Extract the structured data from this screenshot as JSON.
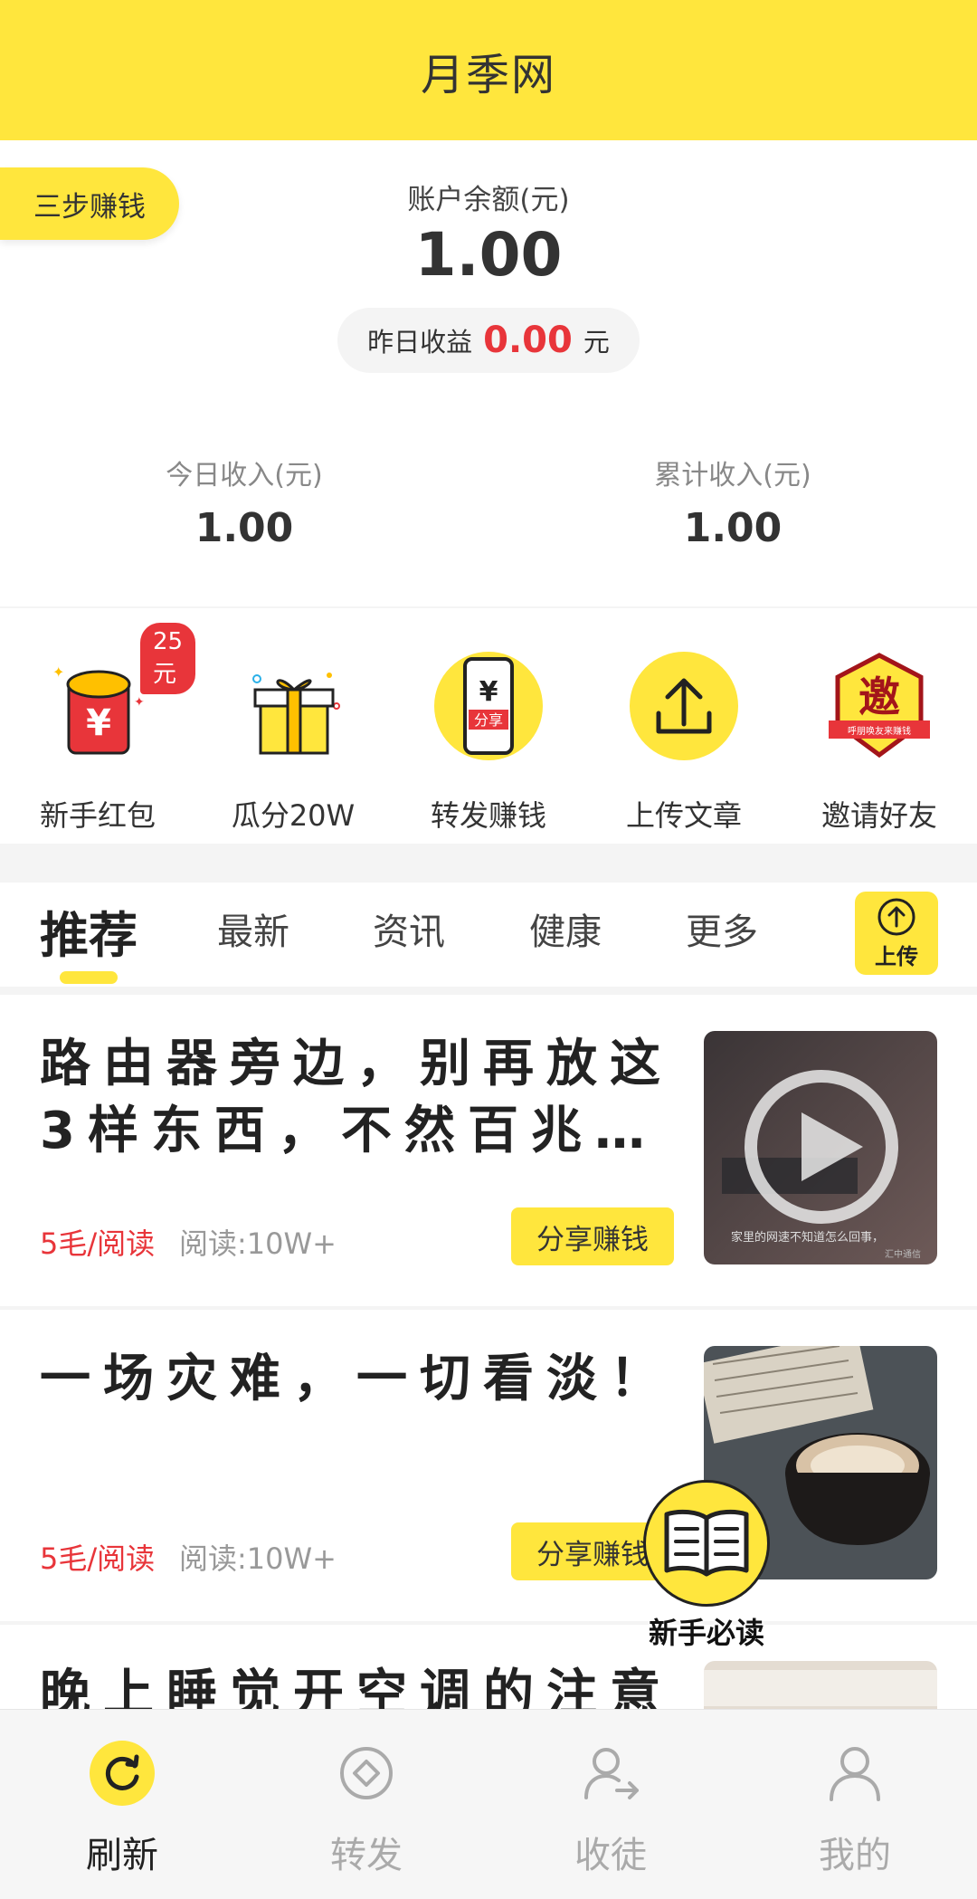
{
  "header": {
    "title": "月季网"
  },
  "balance": {
    "steps_button": "三步赚钱",
    "label": "账户余额(元)",
    "value": "1.00",
    "yesterday_label": "昨日收益",
    "yesterday_value": "0.00",
    "yesterday_unit": "元",
    "today_label": "今日收入(元)",
    "today_value": "1.00",
    "total_label": "累计收入(元)",
    "total_value": "1.00"
  },
  "shortcuts": [
    {
      "label": "新手红包",
      "badge": "25元",
      "icon": "red-packet-icon"
    },
    {
      "label": "瓜分20W",
      "icon": "gift-box-icon"
    },
    {
      "label": "转发赚钱",
      "icon": "phone-share-icon",
      "glyph": "¥",
      "sub": "分享"
    },
    {
      "label": "上传文章",
      "icon": "upload-icon"
    },
    {
      "label": "邀请好友",
      "icon": "invite-badge-icon",
      "glyph": "邀",
      "sub": "呼朋唤友来赚钱"
    }
  ],
  "tabs": {
    "items": [
      "推荐",
      "最新",
      "资讯",
      "健康",
      "更多"
    ],
    "active": "推荐",
    "upload_label": "上传"
  },
  "articles": [
    {
      "title": "路由器旁边，别再放这3样东西，不然百兆…",
      "price": "5毛/阅读",
      "reads": "阅读:10W+",
      "share": "分享赚钱",
      "thumb_caption": "家里的网速不知道怎么回事，",
      "thumb_source": "汇中通信"
    },
    {
      "title": "一场灾难，一切看淡！",
      "price": "5毛/阅读",
      "reads": "阅读:10W+",
      "share": "分享赚钱"
    },
    {
      "title": "晚上睡觉开空调的注意"
    }
  ],
  "guide": {
    "label": "新手必读"
  },
  "bottom_nav": [
    {
      "label": "刷新",
      "icon": "refresh-icon",
      "active": true
    },
    {
      "label": "转发",
      "icon": "forward-icon",
      "active": false
    },
    {
      "label": "收徒",
      "icon": "add-disciple-icon",
      "active": false
    },
    {
      "label": "我的",
      "icon": "profile-icon",
      "active": false
    }
  ],
  "colors": {
    "brand_yellow": "#ffe63d",
    "accent_red": "#e8353a"
  }
}
